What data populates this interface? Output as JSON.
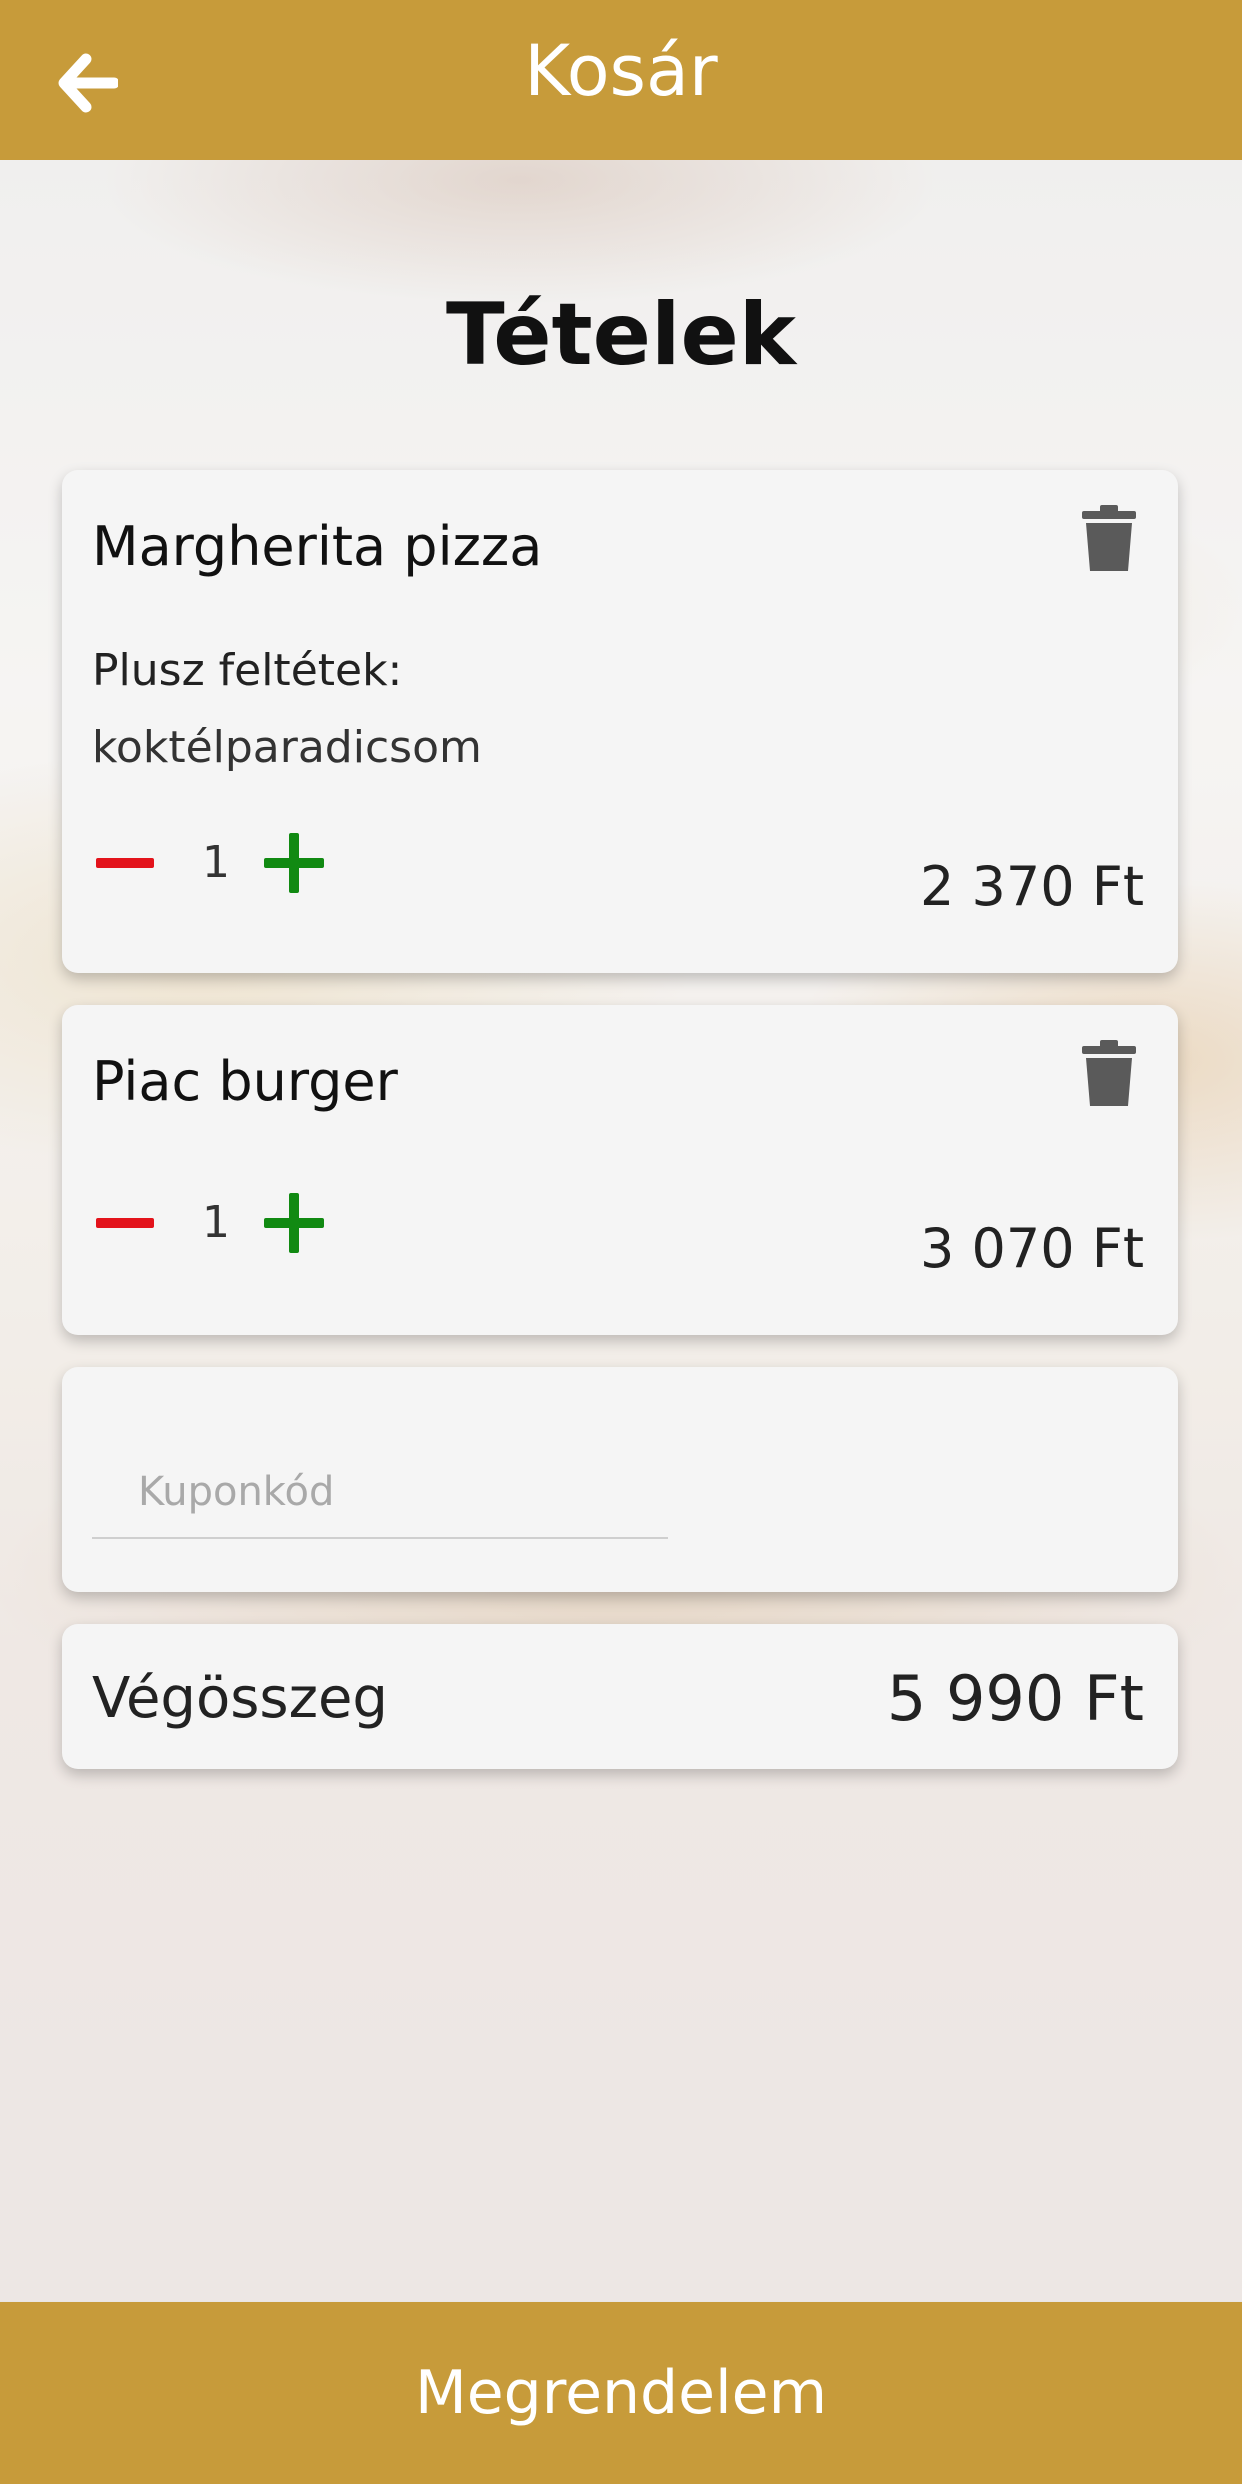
{
  "header": {
    "title": "Kosár",
    "back_icon": "arrow-left-icon"
  },
  "section": {
    "title": "Tételek"
  },
  "items": [
    {
      "name": "Margherita pizza",
      "extras_label": "Plusz feltétek:",
      "extras": "koktélparadicsom",
      "quantity": "1",
      "price": "2 370 Ft"
    },
    {
      "name": "Piac burger",
      "quantity": "1",
      "price": "3 070 Ft"
    }
  ],
  "coupon": {
    "placeholder": "Kuponkód",
    "value": ""
  },
  "total": {
    "label": "Végösszeg",
    "value": "5 990 Ft"
  },
  "order_button": {
    "label": "Megrendelem"
  },
  "colors": {
    "accent": "#c79b3a",
    "minus": "#e3131b",
    "plus": "#118a12",
    "trash": "#5a5a5a"
  }
}
